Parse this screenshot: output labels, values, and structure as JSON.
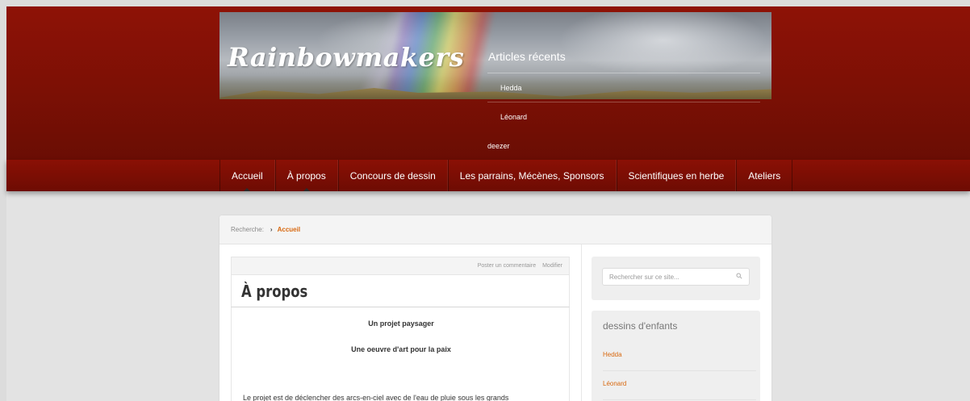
{
  "site": {
    "logo": "Rainbowmakers"
  },
  "recent_posts": {
    "title": "Articles récents",
    "items": [
      "Hedda",
      "Léonard",
      "deezer"
    ]
  },
  "nav": {
    "items": [
      {
        "label": "Accueil"
      },
      {
        "label": "À propos"
      },
      {
        "label": "Concours de dessin"
      },
      {
        "label": "Les parrains, Mécènes, Sponsors"
      },
      {
        "label": "Scientifiques en herbe"
      },
      {
        "label": "Ateliers"
      }
    ]
  },
  "breadcrumb": {
    "prefix": "Recherche:",
    "current": "Accueil"
  },
  "post": {
    "meta_comment": "Poster un commentaire",
    "meta_edit": "Modifier",
    "title": "À propos",
    "heading1": "Un projet paysager",
    "heading2": "Une oeuvre d'art pour la paix",
    "paragraph": "Le projet est de déclencher des arcs-en-ciel avec de l'eau de pluie sous les grands"
  },
  "sidebar": {
    "search_placeholder": "Rechercher sur ce site...",
    "widget_title": "dessins d'enfants",
    "widget_items": [
      "Hedda",
      "Léonard"
    ]
  },
  "colors": {
    "header": "#7c1005",
    "accent": "#d8680f",
    "background": "#e3e3e3"
  }
}
